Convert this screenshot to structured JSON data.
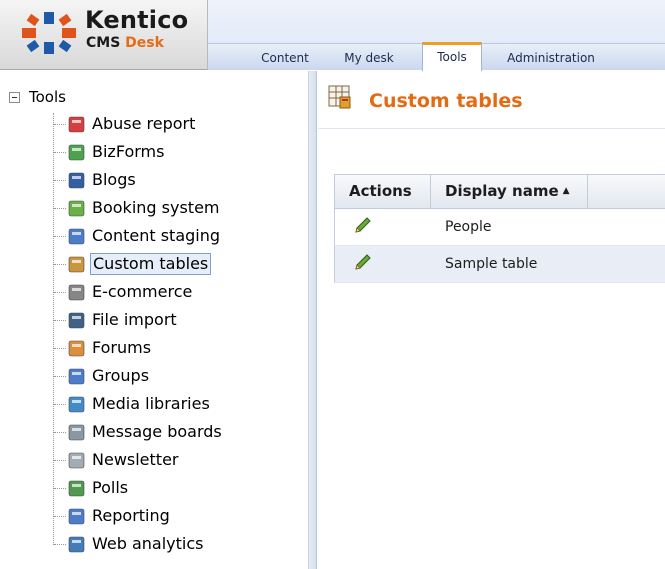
{
  "app": {
    "brand": "Kentico",
    "sub_cms": "CMS",
    "sub_desk": "Desk"
  },
  "tabs": [
    {
      "label": "Content",
      "active": false
    },
    {
      "label": "My desk",
      "active": false
    },
    {
      "label": "Tools",
      "active": true
    },
    {
      "label": "Administration",
      "active": false
    }
  ],
  "tree": {
    "root": "Tools",
    "items": [
      {
        "label": "Abuse report",
        "icon": "abuse-report-icon",
        "color": "#d22b2b"
      },
      {
        "label": "BizForms",
        "icon": "bizforms-icon",
        "color": "#3a9a3a"
      },
      {
        "label": "Blogs",
        "icon": "blogs-icon",
        "color": "#1f4f9a"
      },
      {
        "label": "Booking system",
        "icon": "booking-icon",
        "color": "#5aa832"
      },
      {
        "label": "Content staging",
        "icon": "content-staging-icon",
        "color": "#3a6fc4"
      },
      {
        "label": "Custom tables",
        "icon": "custom-tables-icon",
        "color": "#c48a2a",
        "selected": true
      },
      {
        "label": "E-commerce",
        "icon": "ecommerce-cart-icon",
        "color": "#7a7a7a"
      },
      {
        "label": "File import",
        "icon": "file-import-icon",
        "color": "#2d4f7a"
      },
      {
        "label": "Forums",
        "icon": "forums-icon",
        "color": "#d9822b"
      },
      {
        "label": "Groups",
        "icon": "groups-icon",
        "color": "#3a6fc4"
      },
      {
        "label": "Media libraries",
        "icon": "media-libraries-icon",
        "color": "#2f7fc1"
      },
      {
        "label": "Message boards",
        "icon": "message-boards-icon",
        "color": "#7f8c9a"
      },
      {
        "label": "Newsletter",
        "icon": "newsletter-icon",
        "color": "#9aa2ab"
      },
      {
        "label": "Polls",
        "icon": "polls-icon",
        "color": "#3f8f3f"
      },
      {
        "label": "Reporting",
        "icon": "reporting-icon",
        "color": "#3a6fc4"
      },
      {
        "label": "Web analytics",
        "icon": "web-analytics-icon",
        "color": "#2f6fb0"
      }
    ]
  },
  "main": {
    "title": "Custom tables",
    "columns": {
      "actions": "Actions",
      "display_name": "Display name"
    },
    "rows": [
      {
        "name": "People"
      },
      {
        "name": "Sample table"
      }
    ]
  }
}
